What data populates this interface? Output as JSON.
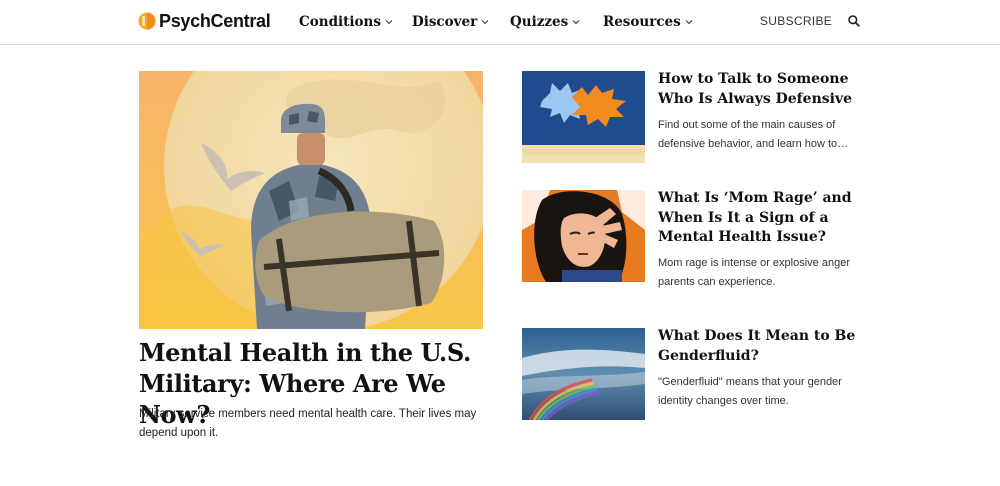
{
  "header": {
    "logo": "PsychCentral",
    "nav": [
      "Conditions",
      "Discover",
      "Quizzes",
      "Resources"
    ],
    "subscribe": "SUBSCRIBE",
    "search_icon": "search-icon",
    "chevron_icon": "chevron-down-icon",
    "accent": "#f7a823"
  },
  "featured": {
    "title": "Mental Health in the U.S. Military: Where Are We Now?",
    "description": "Military service members need mental health care. Their lives may depend upon it.",
    "image": "soldier-with-duffel-bag-and-doves"
  },
  "articles": [
    {
      "title": "How to Talk to Someone Who Is Always Defensive",
      "description": "Find out some of the main causes of defensive behavior, and learn how to…",
      "image": "speech-bubbles-illustration"
    },
    {
      "title": "What Is ‘Mom Rage’ and When Is It a Sign of a Mental Health Issue?",
      "description": "Mom rage is intense or explosive anger parents can experience.",
      "image": "stressed-woman-illustration"
    },
    {
      "title": "What Does It Mean to Be Genderfluid?",
      "description": "\"Genderfluid\" means that your gender identity changes over time.",
      "image": "rainbow-sky-image"
    }
  ]
}
